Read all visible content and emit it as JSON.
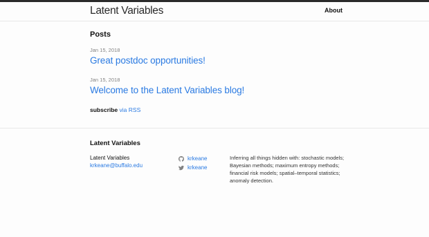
{
  "header": {
    "site_title": "Latent Variables",
    "nav": {
      "about_label": "About"
    }
  },
  "main": {
    "posts_heading": "Posts",
    "posts": [
      {
        "date": "Jan 15, 2018",
        "title": "Great postdoc opportunities!"
      },
      {
        "date": "Jan 15, 2018",
        "title": "Welcome to the Latent Variables blog!"
      }
    ],
    "subscribe": {
      "label": "subscribe",
      "link_text": "via RSS"
    }
  },
  "footer": {
    "heading": "Latent Variables",
    "name": "Latent Variables",
    "email": "krkeane@buffalo.edu",
    "social": [
      {
        "icon": "github-icon",
        "handle": "krkeane"
      },
      {
        "icon": "twitter-icon",
        "handle": "krkeane"
      }
    ],
    "description": "Inferring all things hidden with: stochastic models; Bayesian methods; maximum entropy methods; financial risk models; spatial–temporal statistics; anomaly detection."
  },
  "colors": {
    "link": "#2a7ae2",
    "text": "#111111",
    "meta": "#828282",
    "top_border": "#2a2a2a",
    "background": "#fdfdfd"
  }
}
